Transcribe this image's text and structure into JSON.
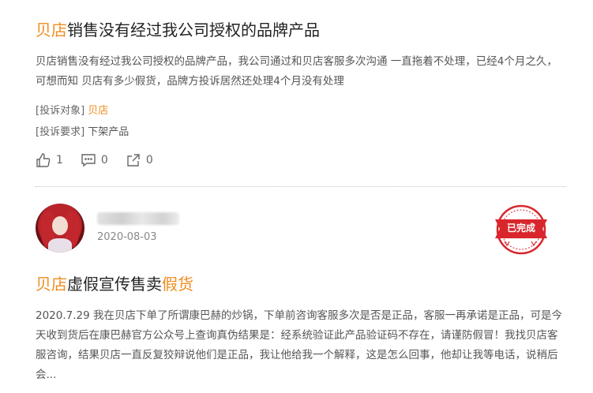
{
  "post1": {
    "title_brand": "贝店",
    "title_rest": "销售没有经过我公司授权的品牌产品",
    "body": "贝店销售没有经过我公司授权的品牌产品，我公司通过和贝店客服多次沟通 一直拖着不处理，已经4个月之久，可想而知 贝店有多少假货，品牌方投诉居然还处理4个月没有处理",
    "target_label": "[投诉对象]",
    "target_value": "贝店",
    "request_label": "[投诉要求]",
    "request_value": "下架产品",
    "likes": "1",
    "comments": "0",
    "shares": "0"
  },
  "post2": {
    "username": "",
    "date": "2020-08-03",
    "status_stamp": "已完成",
    "title_brand": "贝店",
    "title_mid": "虚假宣传售卖",
    "title_end": "假货",
    "body": "2020.7.29 我在贝店下单了所谓康巴赫的炒锅，下单前咨询客服多次是否是正品，客服一再承诺是正品，可是今天收到货后在康巴赫官方公众号上查询真伪结果是：经系统验证此产品验证码不存在，请谨防假冒！我找贝店客服咨询，结果贝店一直反复狡辩说他们是正品，我让他给我一个解释，这是怎么回事，他却让我等电话，说稍后会..."
  },
  "colors": {
    "accent": "#f08c1e",
    "stamp": "#d9262c"
  },
  "icons": [
    "thumbs-up-icon",
    "comment-icon",
    "share-icon"
  ]
}
